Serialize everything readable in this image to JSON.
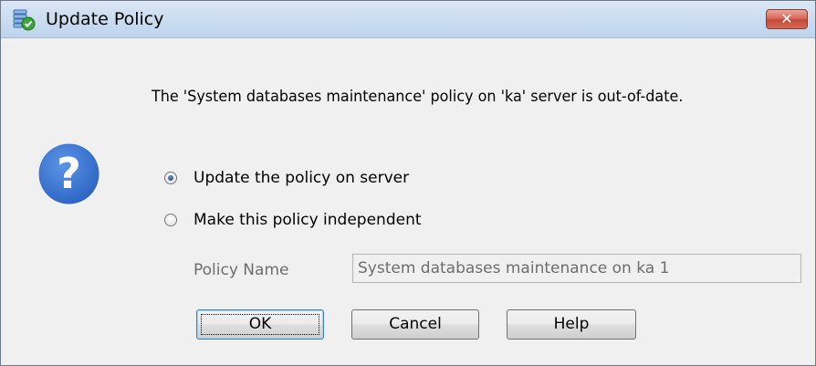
{
  "window": {
    "title": "Update Policy",
    "close_symbol": "✕",
    "title_icon": "database-policy-icon"
  },
  "dialog": {
    "message": "The 'System databases maintenance' policy on 'ka' server is out-of-date.",
    "icon": "question-icon",
    "icon_color": "#3a78d8",
    "options": [
      {
        "label": "Update the policy on server",
        "checked": true
      },
      {
        "label": "Make this policy independent",
        "checked": false
      }
    ],
    "policy_name": {
      "label": "Policy Name",
      "value": "System databases maintenance on ka 1"
    }
  },
  "buttons": {
    "ok": "OK",
    "cancel": "Cancel",
    "help": "Help"
  },
  "colors": {
    "titlebar": "#c9dcf0",
    "close_button": "#c44a3a",
    "background": "#f0f0f0"
  }
}
